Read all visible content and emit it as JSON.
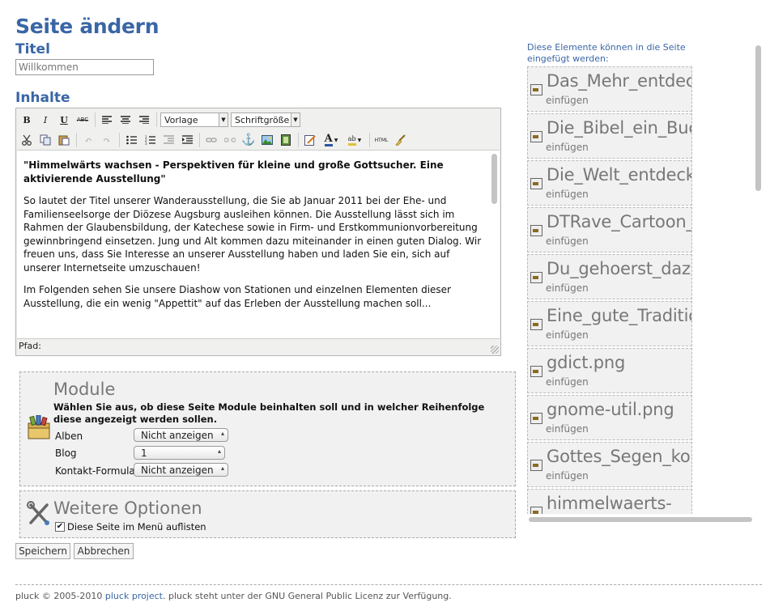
{
  "page": {
    "title": "Seite ändern"
  },
  "form": {
    "title_label": "Titel",
    "title_value": "Willkommen",
    "content_label": "Inhalte"
  },
  "editor": {
    "style_select": "Vorlage",
    "font_size_select": "Schriftgröße",
    "heading": "\"Himmelwärts wachsen - Perspektiven für kleine und große Gottsucher. Eine aktivierende Ausstellung\"",
    "paragraph1": "So lautet der Titel unserer Wanderausstellung, die Sie ab Januar 2011 bei der Ehe- und Familienseelsorge der Diözese Augsburg ausleihen können. Die Ausstellung lässt sich im Rahmen der Glaubensbildung, der Katechese sowie in Firm- und Erstkommunionvorbereitung gewinnbringend einsetzen. Jung und Alt kommen dazu miteinander in einen guten Dialog. Wir freuen uns, dass Sie Interesse an unserer Ausstellung haben und laden Sie ein, sich auf unserer Internetseite umzuschauen!",
    "paragraph2": "Im Folgenden sehen Sie unsere Diashow von Stationen und einzelnen Elementen dieser Ausstellung, die ein wenig \"Appettit\" auf das Erleben der Ausstellung machen soll...",
    "path_label": "Pfad:"
  },
  "modules": {
    "title": "Module",
    "description": "Wählen Sie aus, ob diese Seite Module beinhalten soll und in welcher Reihenfolge diese angezeigt werden sollen.",
    "rows": [
      {
        "label": "Alben",
        "value": "Nicht anzeigen"
      },
      {
        "label": "Blog",
        "value": "1"
      },
      {
        "label": "Kontakt-Formular",
        "value": "Nicht anzeigen"
      }
    ]
  },
  "options": {
    "title": "Weitere Optionen",
    "checkbox_label": "Diese Seite im Menü auflisten",
    "checked": true
  },
  "buttons": {
    "save": "Speichern",
    "cancel": "Abbrechen"
  },
  "footer": {
    "prefix": "pluck © 2005-2010 ",
    "link": "pluck project",
    "suffix": ". pluck steht unter der GNU General Public Licenz zur Verfügung."
  },
  "sidebar": {
    "label": "Diese Elemente können in die Seite eingefügt werden:",
    "insert_label": "einfügen",
    "items": [
      "Das_Mehr_entdecken.jpg",
      "Die_Bibel_ein_Buch.jpg",
      "Die_Welt_entdecken.jpg",
      "DTRave_Cartoon_Car.png",
      "Du_gehoerst_dazu.jpg",
      "Eine_gute_Tradition.jpg",
      "gdict.png",
      "gnome-util.png",
      "Gottes_Segen_kommt_ur",
      "himmelwaerts-"
    ]
  },
  "colors": {
    "accent": "#3a66a6",
    "panel": "#f1f1f1",
    "muted": "#777777"
  }
}
